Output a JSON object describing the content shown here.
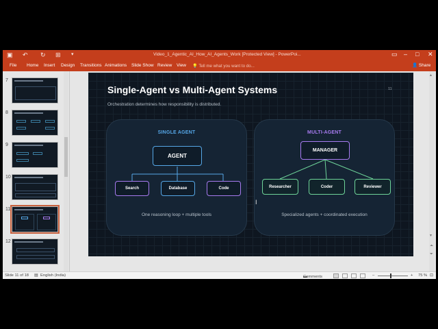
{
  "window": {
    "title": "Video_1_Agentic_AI_How_AI_Agents_Work [Protected View] - PowerPoi...",
    "quick_access": [
      "save",
      "undo",
      "redo",
      "start-from-beginning",
      "customize"
    ],
    "controls": [
      "restore-ribbon",
      "minimize",
      "maximize",
      "close"
    ]
  },
  "ribbon": {
    "tabs": [
      "File",
      "Home",
      "Insert",
      "Design",
      "Transitions",
      "Animations",
      "Slide Show",
      "Review",
      "View"
    ],
    "tell_me": "Tell me what you want to do...",
    "share": "Share"
  },
  "thumbnails": [
    {
      "num": "7"
    },
    {
      "num": "8"
    },
    {
      "num": "9"
    },
    {
      "num": "10"
    },
    {
      "num": "11",
      "active": true
    },
    {
      "num": "12"
    }
  ],
  "slide": {
    "title": "Single-Agent vs Multi-Agent Systems",
    "number": "11",
    "subtitle": "Orchestration determines how responsibility is distributed.",
    "single": {
      "heading": "SINGLE AGENT",
      "center": "AGENT",
      "tools": [
        "Search",
        "Database",
        "Code"
      ],
      "caption": "One reasoning loop + multiple tools"
    },
    "multi": {
      "heading": "MULTI-AGENT",
      "center": "MANAGER",
      "agents": [
        "Researcher",
        "Coder",
        "Reviewer"
      ],
      "caption": "Specialized agents + coordinated execution"
    }
  },
  "status": {
    "slide_info": "Slide 11 of 18",
    "language": "English (India)",
    "comments": "Comments",
    "zoom": "75 %"
  },
  "colors": {
    "accent": "#c43e1c",
    "blue": "#56a8e8",
    "purple": "#a77bf0",
    "green": "#6fd59a"
  }
}
